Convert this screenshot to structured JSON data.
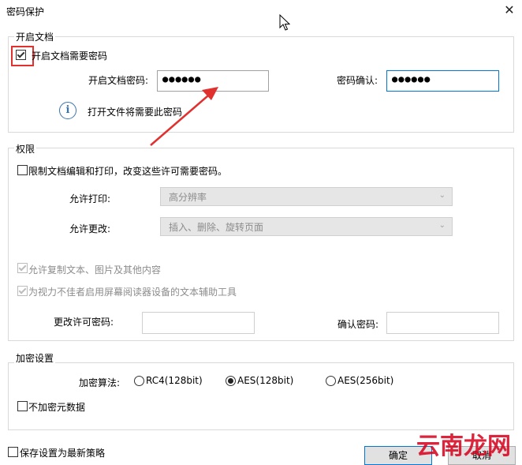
{
  "window": {
    "title": "密码保护",
    "close_glyph": "✕"
  },
  "open_doc": {
    "group_label": "开启文档",
    "require_password_label": "开启文档需要密码",
    "require_password_checked": true,
    "password_label": "开启文档密码:",
    "password_value": "●●●●●●",
    "confirm_label": "密码确认:",
    "confirm_value": "●●●●●●",
    "info_text": "打开文件将需要此密码"
  },
  "permissions": {
    "group_label": "权限",
    "restrict_label": "限制文档编辑和打印，改变这些许可需要密码。",
    "restrict_checked": false,
    "print_label": "允许打印:",
    "print_value": "高分辨率",
    "change_label": "允许更改:",
    "change_value": "插入、删除、旋转页面",
    "copy_label": "允许复制文本、图片及其他内容",
    "copy_checked": true,
    "accessibility_label": "为视力不佳者启用屏幕阅读器设备的文本辅助工具",
    "accessibility_checked": true,
    "change_password_label": "更改许可密码:",
    "change_password_value": "",
    "confirm_password_label": "确认密码:",
    "confirm_password_value": ""
  },
  "encryption": {
    "group_label": "加密设置",
    "algorithm_label": "加密算法:",
    "options": [
      "RC4(128bit)",
      "AES(128bit)",
      "AES(256bit)"
    ],
    "selected": "AES(128bit)",
    "no_metadata_label": "不加密元数据",
    "no_metadata_checked": false
  },
  "footer": {
    "save_policy_label": "保存设置为最新策略",
    "save_policy_checked": false,
    "ok_label": "确定",
    "cancel_label": "取消"
  },
  "watermark": {
    "text": "云南龙网"
  },
  "colors": {
    "highlight": "#e0312f",
    "accent": "#0078d7",
    "info": "#3a74b0"
  }
}
